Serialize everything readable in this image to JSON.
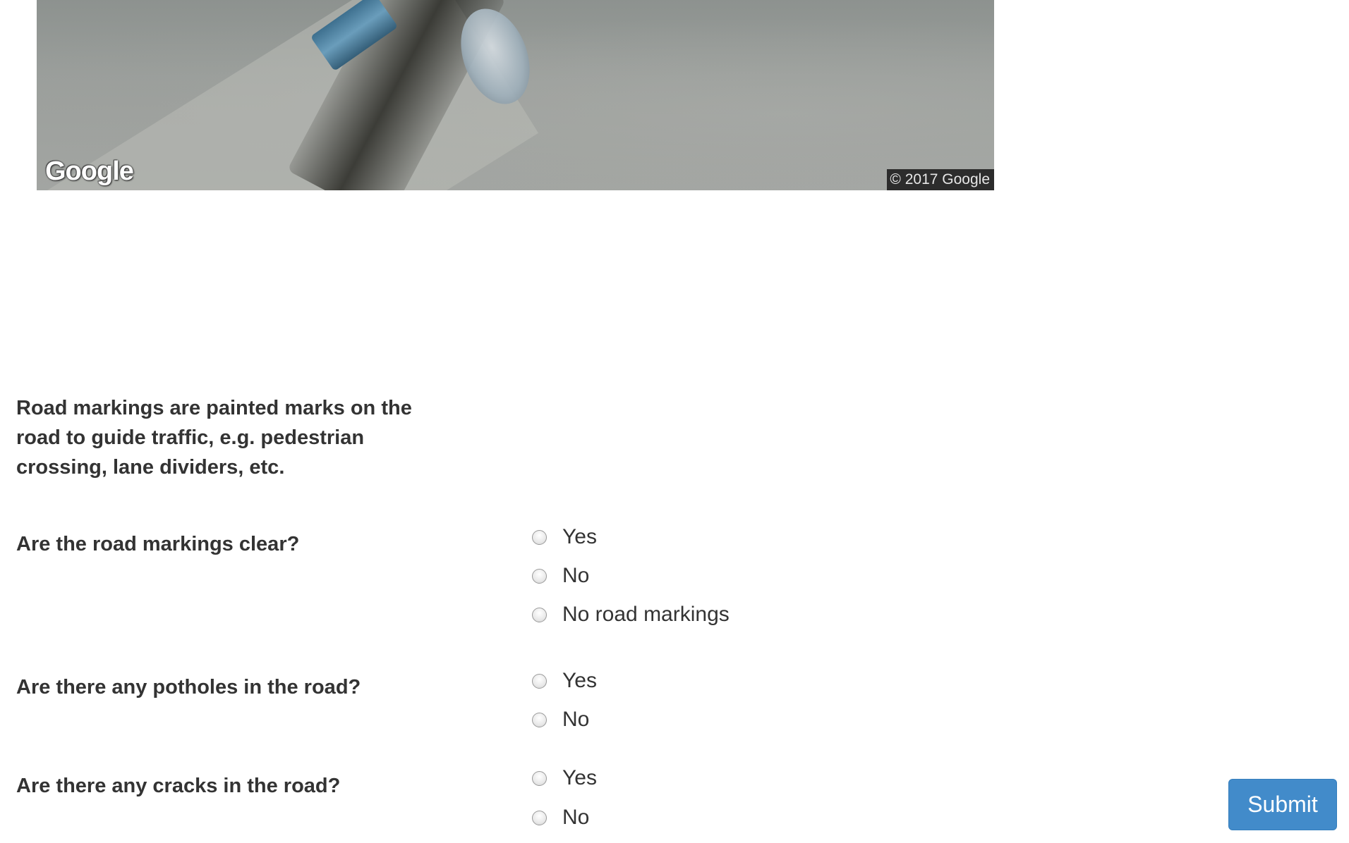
{
  "street_view": {
    "logo": "Google",
    "copyright": "© 2017 Google"
  },
  "form": {
    "intro": "Road markings are painted marks on the road to guide traffic, e.g. pedestrian crossing, lane dividers, etc.",
    "questions": [
      {
        "label": "Are the road markings clear?",
        "options": [
          "Yes",
          "No",
          "No road markings"
        ]
      },
      {
        "label": "Are there any potholes in the road?",
        "options": [
          "Yes",
          "No"
        ]
      },
      {
        "label": "Are there any cracks in the road?",
        "options": [
          "Yes",
          "No"
        ]
      }
    ],
    "submit_label": "Submit"
  },
  "colors": {
    "submit_bg": "#428bca",
    "text": "#333333"
  }
}
